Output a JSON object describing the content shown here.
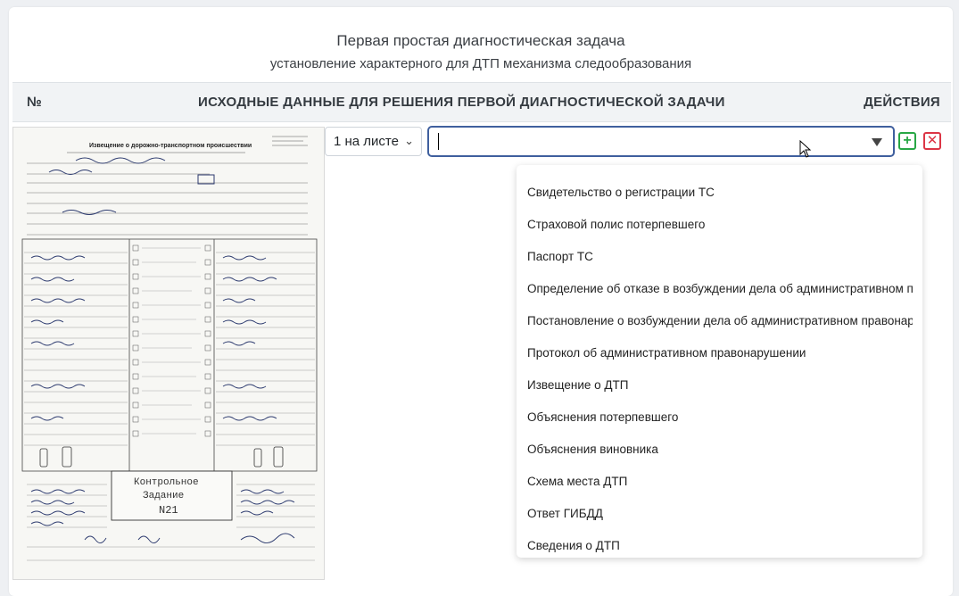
{
  "header": {
    "title": "Первая простая диагностическая задача",
    "subtitle": "установление характерного для ДТП механизма следообразования"
  },
  "table": {
    "col_num": "№",
    "col_data": "ИСХОДНЫЕ ДАННЫЕ ДЛЯ РЕШЕНИЯ ПЕРВОЙ ДИАГНОСТИЧЕСКОЙ ЗАДАЧИ",
    "col_actions": "ДЕЙСТВИЯ"
  },
  "row": {
    "pages_select": "1 на листе",
    "doc_type_value": "",
    "add_label": "+",
    "delete_label": "✕"
  },
  "document": {
    "heading": "Извещение о дорожно-транспортном происшествии",
    "stamp_line1": "Контрольное",
    "stamp_line2": "Задание",
    "stamp_line3": "N21"
  },
  "dropdown": {
    "options": [
      "Свидетельство о регистрации ТС",
      "Страховой полис потерпевшего",
      "Паспорт ТС",
      "Определение об отказе в возбуждении дела об административном пр",
      "Постановление о возбуждении дела об административном правонару",
      "Протокол об административном правонарушении",
      "Извещение о ДТП",
      "Объяснения потерпевшего",
      "Объяснения виновника",
      "Схема места ДТП",
      "Ответ ГИБДД",
      "Сведения о ДТП"
    ]
  },
  "colors": {
    "accent_border": "#3f5f9e",
    "add_green": "#28a745",
    "delete_red": "#dc3545"
  }
}
